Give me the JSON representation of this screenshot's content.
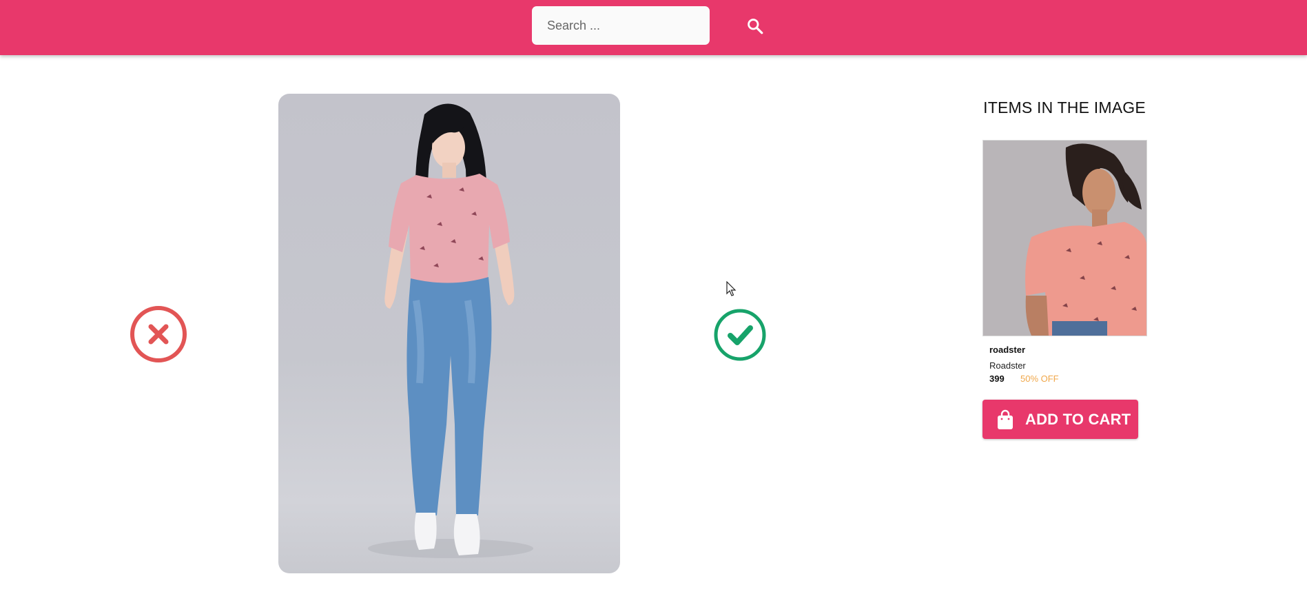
{
  "header": {
    "search": {
      "placeholder": "Search ...",
      "value": ""
    },
    "search_icon": "search-icon",
    "background_color": "#e8386b"
  },
  "main": {
    "reject_icon": "close-circle-icon",
    "reject_color": "#e25555",
    "accept_icon": "check-circle-icon",
    "accept_color": "#17a36a"
  },
  "items_panel": {
    "title": "ITEMS IN THE IMAGE",
    "items": [
      {
        "brand": "roadster",
        "name": "Roadster",
        "price": "399",
        "discount": "50% OFF",
        "cta_label": "ADD TO CART",
        "cta_icon": "shopping-bag-icon"
      }
    ]
  },
  "colors": {
    "accent": "#e8386b",
    "discount": "#f0a74a"
  }
}
